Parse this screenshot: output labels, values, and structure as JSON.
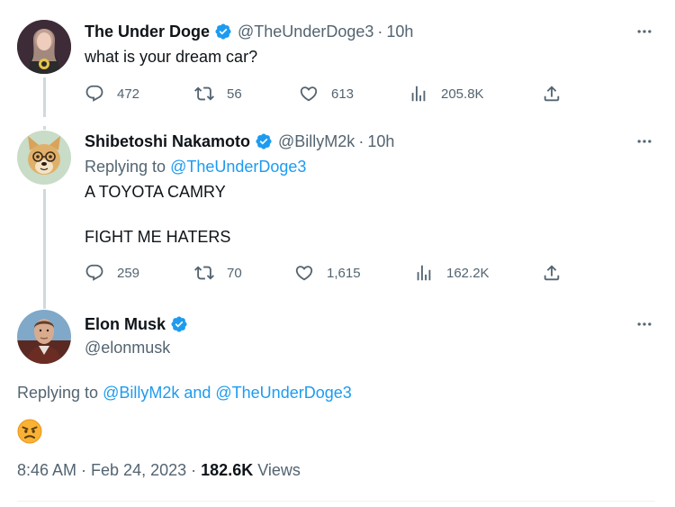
{
  "tweets": [
    {
      "name": "The Under Doge",
      "handle": "@TheUnderDoge3",
      "time": "10h",
      "text": "what is your dream car?",
      "stats": {
        "replies": "472",
        "retweets": "56",
        "likes": "613",
        "views": "205.8K"
      }
    },
    {
      "name": "Shibetoshi Nakamoto",
      "handle": "@BillyM2k",
      "time": "10h",
      "replying_label": "Replying to",
      "replying_to": "@TheUnderDoge3",
      "text_line1": "A TOYOTA CAMRY",
      "text_line2": "FIGHT ME HATERS",
      "stats": {
        "replies": "259",
        "retweets": "70",
        "likes": "1,615",
        "views": "162.2K"
      }
    }
  ],
  "main_tweet": {
    "name": "Elon Musk",
    "handle": "@elonmusk",
    "replying_label": "Replying to",
    "replying_to": "@BillyM2k and @TheUnderDoge3",
    "emoji": "angry-face",
    "timestamp": "8:46 AM · Feb 24, 2023",
    "views_count": "182.6K",
    "views_label": "Views"
  },
  "colors": {
    "verified": "#1d9bf0",
    "link": "#1d9bf0",
    "secondary_text": "#536471"
  },
  "separator": "·"
}
